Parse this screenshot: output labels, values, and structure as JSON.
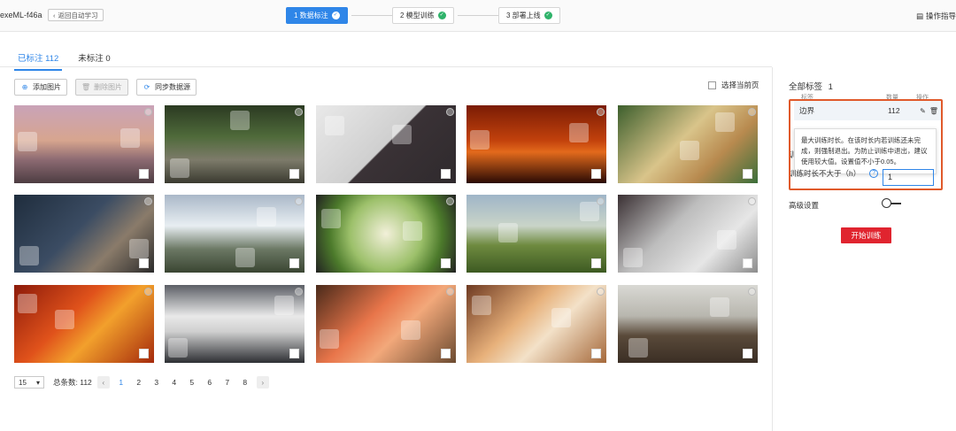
{
  "header": {
    "app_title": "exeML-f46a",
    "back_label": "返回自动学习",
    "steps": [
      {
        "label": "1 数据标注",
        "done": true,
        "active": true
      },
      {
        "label": "2 模型训练",
        "done": true,
        "active": false
      },
      {
        "label": "3 部署上线",
        "done": true,
        "active": false
      }
    ],
    "guide_label": "操作指导"
  },
  "tabs": [
    {
      "label": "已标注 112",
      "active": true
    },
    {
      "label": "未标注 0",
      "active": false
    }
  ],
  "toolbar": {
    "add_label": "添加图片",
    "delete_label": "删除图片",
    "sync_label": "同步数据源",
    "select_page_label": "选择当前页"
  },
  "images": [
    {
      "desc": "sunset-castle",
      "bg": "linear-gradient(180deg,#c9a3b8 0%,#d7a58f 45%,#8c6a72 70%,#4d3d42 100%)"
    },
    {
      "desc": "forest-bridge",
      "bg": "linear-gradient(180deg,#2b3a22 0%,#4f6a3a 40%,#7d7b6a 70%,#3a3a30 100%)"
    },
    {
      "desc": "laptop-coffee",
      "bg": "linear-gradient(135deg,#e9e9e9 0%,#cfcfcf 50%,#3a3236 51%,#2f2a2d 100%)"
    },
    {
      "desc": "red-sky",
      "bg": "linear-gradient(180deg,#7a1c05 0%,#c2410c 45%,#e36a1c 60%,#2a0a04 100%)"
    },
    {
      "desc": "pizza-table",
      "bg": "linear-gradient(135deg,#3d5f2d 0%,#d9c48a 45%,#b88a4f 70%,#3b6e3a 100%)"
    },
    {
      "desc": "hands-camera",
      "bg": "linear-gradient(135deg,#1f2d3d 0%,#3b4c63 45%,#8a7b6a 70%,#2b2b2b 100%)"
    },
    {
      "desc": "snowy-mountain",
      "bg": "linear-gradient(180deg,#aab8c8 0%,#e8eef2 40%,#6b7864 70%,#3a4532 100%)"
    },
    {
      "desc": "salad-plate",
      "bg": "radial-gradient(circle at 50% 50%,#f2f0d9 0%,#9cc06a 45%,#4c7a2b 70%,#222 100%)"
    },
    {
      "desc": "park-bench",
      "bg": "linear-gradient(180deg,#9fb5c8 0%,#c9d4c8 40%,#6e8a3f 65%,#3d5a22 100%)"
    },
    {
      "desc": "laptop-keyboard",
      "bg": "linear-gradient(135deg,#3a3033 0%,#bdbdbd 40%,#e6e6e6 70%,#8c8c8c 100%)"
    },
    {
      "desc": "autumn-leaf",
      "bg": "linear-gradient(135deg,#8c1a0a 0%,#e0521b 40%,#f2a02c 60%,#a52a0c 100%)"
    },
    {
      "desc": "laptop-desk",
      "bg": "linear-gradient(180deg,#5c5f66 0%,#e9e9e9 40%,#cfcfcf 60%,#2d2f33 100%)"
    },
    {
      "desc": "salmon-fillet",
      "bg": "linear-gradient(135deg,#4a2a1a 0%,#e8754a 40%,#f2a87a 60%,#6b4a30 100%)"
    },
    {
      "desc": "pastry-rolls",
      "bg": "linear-gradient(135deg,#6e3a22 0%,#e7b07a 40%,#f3e1c8 60%,#a5683a 100%)"
    },
    {
      "desc": "vintage-car",
      "bg": "linear-gradient(180deg,#d9d9d4 0%,#b8b6ae 40%,#5a4a3a 65%,#3a2e24 100%)"
    }
  ],
  "pagination": {
    "page_size": "15",
    "total_label": "总条数: 112",
    "pages": [
      "1",
      "2",
      "3",
      "4",
      "5",
      "6",
      "7",
      "8"
    ],
    "current": "1"
  },
  "right_panel": {
    "all_labels_title": "全部标签",
    "all_labels_count": "1",
    "col_label": "标签",
    "col_count": "数量",
    "col_action": "操作",
    "label_name": "边界",
    "label_count": "112",
    "tooltip": "最大训练时长。在该时长内若训练还未完成，则强制退出。为防止训练中退出，建议使用较大值。设置值不小于0.05。",
    "duration_label": "训练时长不大于（h）",
    "duration_value": "1",
    "side_mark": "训",
    "advanced_label": "高级设置",
    "start_label": "开始训练"
  }
}
